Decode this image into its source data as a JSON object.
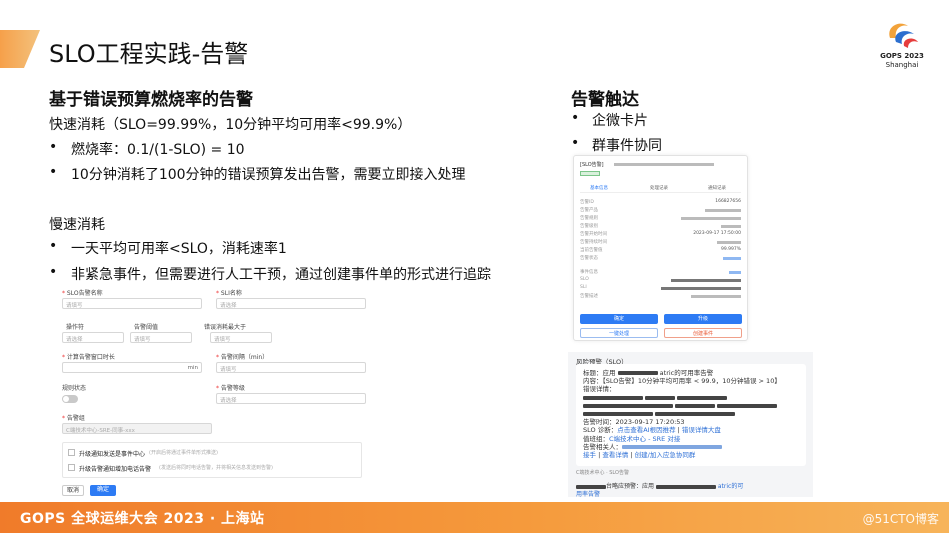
{
  "slide": {
    "title": "SLO工程实践-告警",
    "logo": {
      "line1": "GOPS 2023",
      "line2": "Shanghai"
    }
  },
  "left": {
    "heading": "基于错误预算燃烧率的告警",
    "fast": {
      "label": "快速消耗（SLO=99.99%，10分钟平均可用率<99.9%）",
      "bullets": [
        "燃烧率：0.1/(1-SLO) = 10",
        "10分钟消耗了100分钟的错误预算发出告警，需要立即接入处理"
      ]
    },
    "slow": {
      "label": "慢速消耗",
      "bullets": [
        "一天平均可用率<SLO，消耗速率1",
        "非紧急事件，但需要进行人工干预，通过创建事件单的形式进行追踪"
      ]
    },
    "bullet_mark": "•"
  },
  "form": {
    "f1_label": "SLO告警名称",
    "f1_ph": "请填写",
    "f2_label": "SLI名称",
    "f2_ph": "请选择",
    "col1": "操作符",
    "col2": "告警阈值",
    "col3": "错误消耗最大于",
    "c1_ph": "请选择",
    "c2_ph": "请填写",
    "c3_ph": "请填写",
    "f3_label": "计算告警窗口时长",
    "f3_unit": "min",
    "f4_label": "告警间隔（min）",
    "f4_ph": "请填写",
    "f5_label": "规则状态",
    "f6_label": "告警等级",
    "f6_ph": "请选择",
    "f7_label": "告警组",
    "f7_val": "C端技术中心-SRE-同事-xxx",
    "opt1": "升级通知发送是事件中心",
    "opt1_note": "(开启后将通过事件单形式推送)",
    "opt2": "升级告警通知增加电话告警",
    "opt2_note": "(发送后将同时电话告警，并将相关信息发送到告警)",
    "cancel": "取消",
    "ok": "确定"
  },
  "right": {
    "heading": "告警触达",
    "bullets": [
      "企微卡片",
      "群事件协同"
    ]
  },
  "card": {
    "header": "[SLO告警]",
    "tabs": [
      "基本信息",
      "处理记录",
      "通知记录"
    ],
    "rows": [
      "告警ID",
      "告警产品",
      "告警规则",
      "告警级别",
      "告警开始时间",
      "告警持续时间",
      "当前告警值",
      "告警状态",
      "事件信息",
      "SLO",
      "SLI",
      "告警描述"
    ],
    "rows_vals": {
      "id": "166827656",
      "time": "2023-09-17 17:50:00",
      "value": "99.997%"
    },
    "btn1": "确定",
    "btn2": "升级",
    "btn3": "一键处理",
    "btn4": "创建事件"
  },
  "chat": {
    "title": "风险预警（SLO）",
    "l1": "标题：应用",
    "l1b": "atric的可用率告警",
    "l2": "内容：【SLO告警】10分钟平均可用率 < 99.9，10分钟错误 > 10】",
    "l3": "错误详情：",
    "l7": "告警时间：2023-09-17 17:20:53",
    "l8a": "SLO 诊断：",
    "l8b": "点击查看AI根因推荐",
    "l8c": "错误详情大盘",
    "l9a": "值班组：",
    "l9b": "C端技术中心 - SRE 对接",
    "l10": "告警相关人：",
    "l11a": "接手",
    "l11b": "查看详情",
    "l11c": "创建/加入应急协同群",
    "footer": "C端技术中心 · SLO告警",
    "tail_a": "台略应预警：应用",
    "tail_b": "atric的可",
    "tail_c": "用率告警"
  },
  "footer": {
    "text": "GOPS 全球运维大会 2023 · 上海站",
    "watermark": "@51CTO博客"
  },
  "colors": {
    "accent": "#f39a45",
    "link": "#2d6fd6",
    "primary": "#2d7bf4",
    "danger": "#e8542f"
  }
}
